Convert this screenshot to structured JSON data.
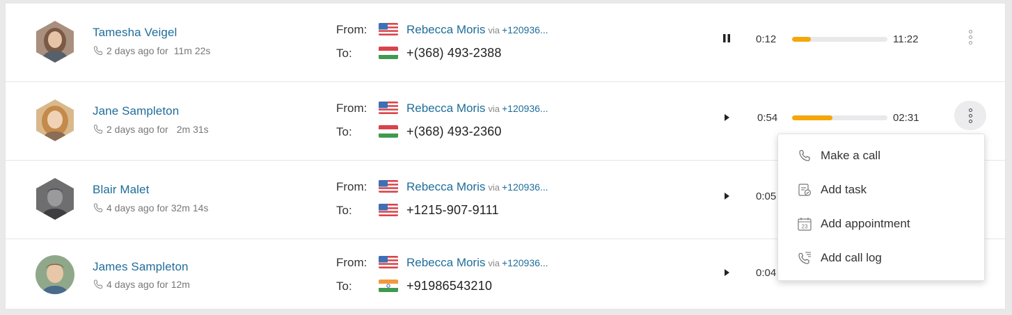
{
  "labels": {
    "from": "From:",
    "to": "To:",
    "via": "via"
  },
  "calls": [
    {
      "name": "Tamesha Veigel",
      "ago": "2 days ago for",
      "duration": "11m 22s",
      "from_name": "Rebecca Moris",
      "from_via": "+120936...",
      "from_flag": "us",
      "to_flag": "hu",
      "to_number": "+(368) 493-2388",
      "control": "pause",
      "time_current": "0:12",
      "progress": 0.2,
      "time_total": "11:22"
    },
    {
      "name": "Jane Sampleton",
      "ago": "2 days ago for",
      "duration": "2m 31s",
      "from_name": "Rebecca Moris",
      "from_via": "+120936...",
      "from_flag": "us",
      "to_flag": "hu",
      "to_number": "+(368) 493-2360",
      "control": "play",
      "time_current": "0:54",
      "progress": 0.42,
      "time_total": "02:31"
    },
    {
      "name": "Blair Malet",
      "ago": "4 days ago for",
      "duration": "32m 14s",
      "from_name": "Rebecca Moris",
      "from_via": "+120936...",
      "from_flag": "us",
      "to_flag": "us",
      "to_number": "+1215-907-9111",
      "control": "play",
      "time_current": "0:05"
    },
    {
      "name": "James Sampleton",
      "ago": "4 days ago for",
      "duration": "12m",
      "from_name": "Rebecca Moris",
      "from_via": "+120936...",
      "from_flag": "us",
      "to_flag": "in",
      "to_number": "+91986543210",
      "control": "play",
      "time_current": "0:04"
    }
  ],
  "menu": {
    "items": [
      {
        "label": "Make a call",
        "icon": "phone-icon"
      },
      {
        "label": "Add task",
        "icon": "task-icon"
      },
      {
        "label": "Add appointment",
        "icon": "calendar-icon"
      },
      {
        "label": "Add call log",
        "icon": "call-log-icon"
      }
    ],
    "calendar_day": "23"
  },
  "colors": {
    "accent": "#f5a60a",
    "link": "#1e6d9a"
  }
}
